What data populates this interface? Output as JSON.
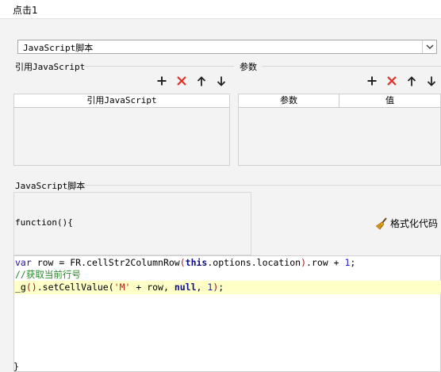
{
  "window": {
    "title": "点击1"
  },
  "script_type": {
    "selected": "JavaScript脚本"
  },
  "referenced_js": {
    "label": "引用JavaScript",
    "column": "引用JavaScript"
  },
  "params": {
    "label": "参数",
    "columns": [
      "参数",
      "值"
    ]
  },
  "script_section": {
    "label": "JavaScript脚本",
    "function_header": "function(){",
    "format_label": "格式化代码",
    "closing_brace": "}"
  },
  "code": {
    "line1": [
      "var",
      " row = FR.cellStr2ColumnRow",
      "(",
      "this",
      ".options.location",
      ")",
      ".row + ",
      "1",
      ";"
    ],
    "line2": "//获取当前行号",
    "line3": [
      "_g",
      "()",
      ".setCellValue(",
      "'M'",
      " + row, ",
      "null",
      ", ",
      "1",
      ")",
      ";"
    ]
  },
  "colors": {
    "add": "#222222",
    "delete": "#e0302a",
    "highlight_line": "#ffffc8",
    "brush": "#e8a31c"
  },
  "icons": [
    "plus-icon",
    "delete-x-icon",
    "arrow-up-icon",
    "arrow-down-icon",
    "broom-icon",
    "chevron-down-icon"
  ]
}
